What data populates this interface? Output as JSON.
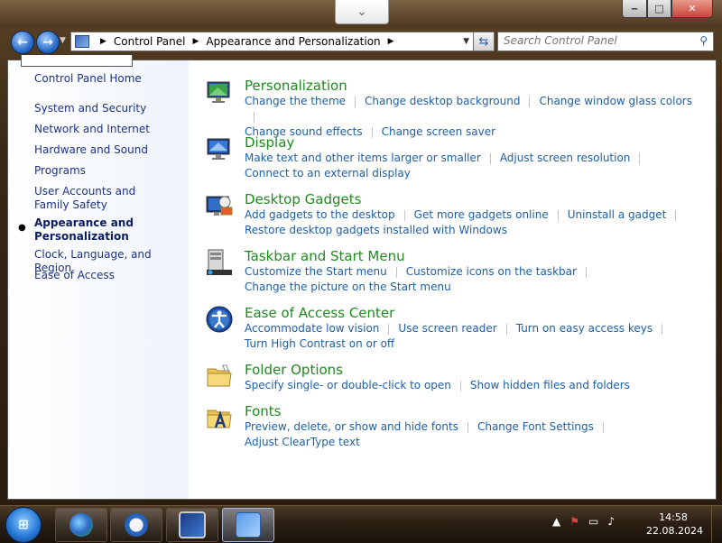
{
  "window": {
    "caption": {
      "minimize": "‒",
      "maximize": "□",
      "close": "✕"
    },
    "peek_glyph": "⌄"
  },
  "address": {
    "crumbs": [
      "Control Panel",
      "Appearance and Personalization"
    ],
    "search_placeholder": "Search Control Panel"
  },
  "sidebar": {
    "items": [
      {
        "label": "Control Panel Home"
      },
      {
        "label": "System and Security"
      },
      {
        "label": "Network and Internet"
      },
      {
        "label": "Hardware and Sound"
      },
      {
        "label": "Programs"
      },
      {
        "label": "User Accounts and Family Safety"
      },
      {
        "label": "Appearance and Personalization"
      },
      {
        "label": "Clock, Language, and Region"
      },
      {
        "label": "Ease of Access"
      }
    ]
  },
  "categories": [
    {
      "title": "Personalization",
      "line1": [
        "Change the theme",
        "Change desktop background",
        "Change window glass colors"
      ],
      "line2": [
        "Change sound effects",
        "Change screen saver"
      ]
    },
    {
      "title": "Display",
      "line1": [
        "Make text and other items larger or smaller",
        "Adjust screen resolution"
      ],
      "line2": [
        "Connect to an external display"
      ]
    },
    {
      "title": "Desktop Gadgets",
      "line1": [
        "Add gadgets to the desktop",
        "Get more gadgets online",
        "Uninstall a gadget"
      ],
      "line2": [
        "Restore desktop gadgets installed with Windows"
      ]
    },
    {
      "title": "Taskbar and Start Menu",
      "line1": [
        "Customize the Start menu",
        "Customize icons on the taskbar"
      ],
      "line2": [
        "Change the picture on the Start menu"
      ]
    },
    {
      "title": "Ease of Access Center",
      "line1": [
        "Accommodate low vision",
        "Use screen reader",
        "Turn on easy access keys"
      ],
      "line2": [
        "Turn High Contrast on or off"
      ]
    },
    {
      "title": "Folder Options",
      "line1": [
        "Specify single- or double-click to open",
        "Show hidden files and folders"
      ],
      "line2": []
    },
    {
      "title": "Fonts",
      "line1": [
        "Preview, delete, or show and hide fonts",
        "Change Font Settings",
        "Adjust ClearType text"
      ],
      "line2": []
    }
  ],
  "taskbar": {
    "clock_time": "14:58",
    "clock_date": "22.08.2024"
  },
  "colors": {
    "title_green": "#1f8a1f",
    "link_blue": "#1e5ea6",
    "sidebar_link": "#1e3287"
  }
}
